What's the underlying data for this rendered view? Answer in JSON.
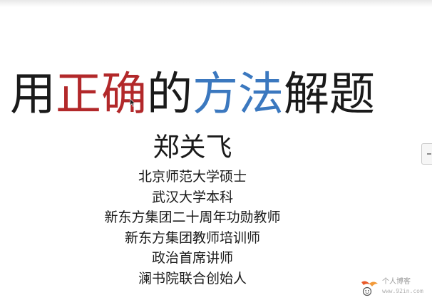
{
  "slide": {
    "title_parts": [
      {
        "text": "用",
        "color": "#1a1a1a"
      },
      {
        "text": "正确",
        "color": "#b2282a"
      },
      {
        "text": "的",
        "color": "#1a1a1a"
      },
      {
        "text": "方法",
        "color": "#3b78bf"
      },
      {
        "text": "解题",
        "color": "#1a1a1a"
      }
    ],
    "presenter_name": "郑关飞",
    "credentials": [
      "北京师范大学硕士",
      "武汉大学本科",
      "新东方集团二十周年功勋教师",
      "新东方集团教师培训师",
      "政治首席讲师",
      "澜书院联合创始人"
    ]
  },
  "watermark": {
    "line1": "个人博客",
    "line2": "www.92in.com"
  },
  "icons": {
    "cursor": "mouse-pointer-icon",
    "side_tab": "side-panel-tab-icon",
    "watermark_logo": "blog-logo-icon"
  }
}
